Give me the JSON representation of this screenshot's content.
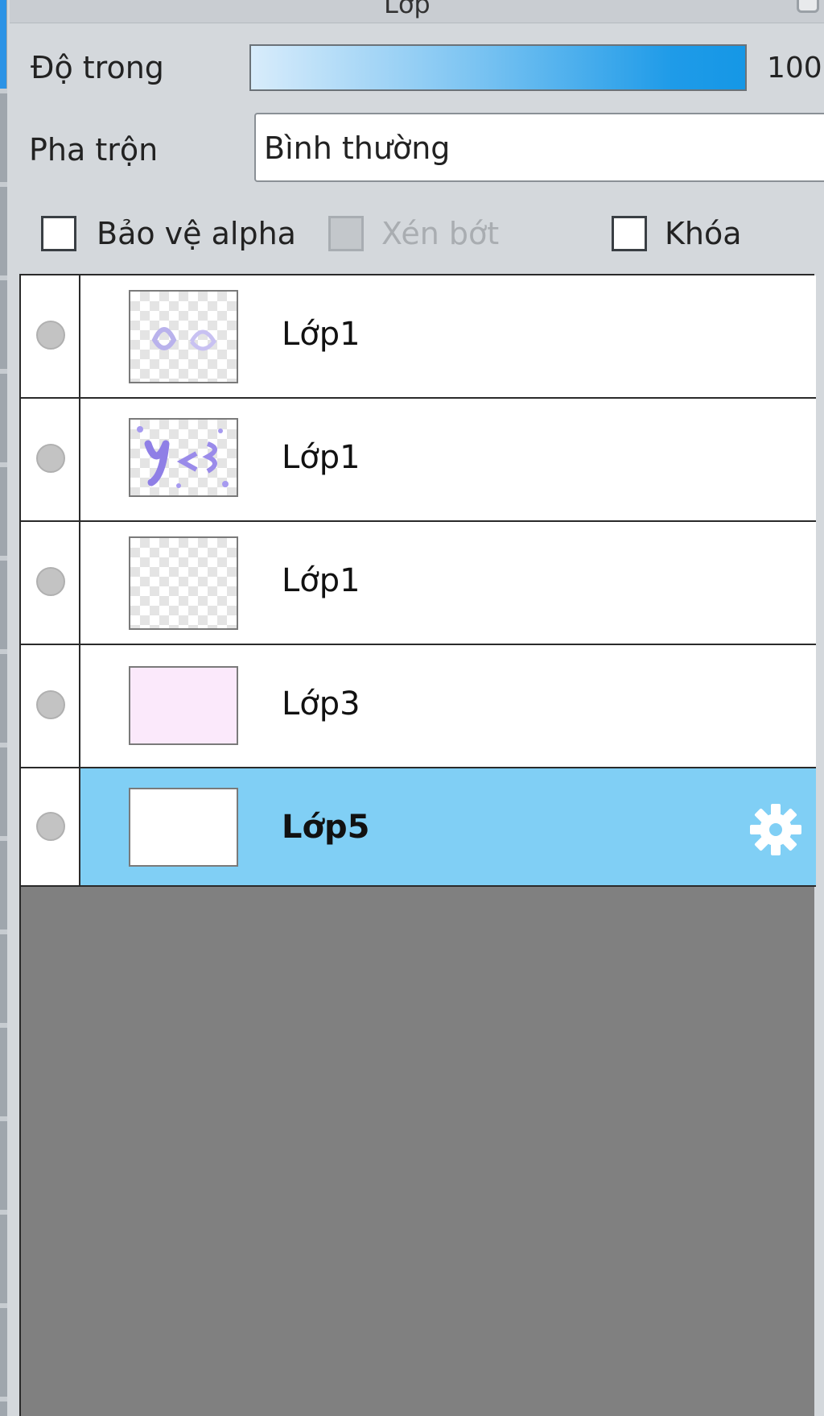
{
  "panel": {
    "title": "Lớp"
  },
  "opacity": {
    "label": "Độ trong",
    "value": "100"
  },
  "blend": {
    "label": "Pha trộn",
    "value": "Bình thường"
  },
  "options": {
    "protect_alpha": {
      "label": "Bảo vệ alpha",
      "checked": false,
      "enabled": true
    },
    "clipping": {
      "label": "Xén bớt",
      "checked": false,
      "enabled": false
    },
    "lock": {
      "label": "Khóa",
      "checked": false,
      "enabled": true
    }
  },
  "layers": [
    {
      "name": "Lớp1",
      "selected": false
    },
    {
      "name": "Lớp1",
      "selected": false
    },
    {
      "name": "Lớp1",
      "selected": false
    },
    {
      "name": "Lớp3",
      "selected": false
    },
    {
      "name": "Lớp5",
      "selected": true
    }
  ],
  "colors": {
    "selected_row": "#80cff5",
    "list_background": "#808080",
    "accent": "#1f9be8"
  },
  "icons": {
    "layer_settings": "gear-icon",
    "visibility": "visibility-dot-icon"
  }
}
